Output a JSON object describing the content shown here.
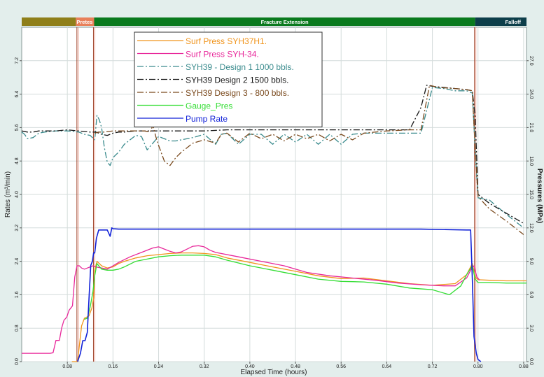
{
  "chart_data": {
    "type": "line",
    "xlabel": "Elapsed Time (hours)",
    "ylabel_left": "Rates (m³/min)",
    "ylabel_right": "Pressures (MPa)",
    "xlim": [
      0.0,
      0.885
    ],
    "ylim_left": [
      0.0,
      8.0
    ],
    "ylim_right": [
      0.0,
      30.0
    ],
    "x_ticks": [
      "0.08",
      "0.16",
      "0.24",
      "0.32",
      "0.40",
      "0.48",
      "0.56",
      "0.64",
      "0.72",
      "0.80",
      "0.88"
    ],
    "x_tick_values": [
      0.08,
      0.16,
      0.24,
      0.32,
      0.4,
      0.48,
      0.56,
      0.64,
      0.72,
      0.8,
      0.88
    ],
    "y_left_ticks": [
      "0.0",
      "0.8",
      "1.6",
      "2.4",
      "3.2",
      "4.0",
      "4.8",
      "5.6",
      "6.4",
      "7.2"
    ],
    "y_left_tick_values": [
      0.0,
      0.8,
      1.6,
      2.4,
      3.2,
      4.0,
      4.8,
      5.6,
      6.4,
      7.2
    ],
    "y_right_ticks": [
      "0.0",
      "3.0",
      "6.0",
      "9.0",
      "12.0",
      "15.0",
      "18.0",
      "21.0",
      "24.0",
      "27.0"
    ],
    "y_right_tick_values": [
      0,
      3,
      6,
      9,
      12,
      15,
      18,
      21,
      24,
      27
    ],
    "grid": true,
    "legend_position": "top-center",
    "stages": [
      {
        "name": "",
        "x0": 0.0,
        "x1": 0.095,
        "color": "#8f7f1a"
      },
      {
        "name": "Pretes",
        "x0": 0.095,
        "x1": 0.127,
        "color": "#e8805a"
      },
      {
        "name": "Fracture Extension",
        "x0": 0.127,
        "x1": 0.795,
        "color": "#0a7a1e"
      },
      {
        "name": "Falloff",
        "x0": 0.795,
        "x1": 0.885,
        "color": "#0d3e4a"
      }
    ],
    "stage_markers": [
      0.098,
      0.127,
      0.795
    ],
    "series": [
      {
        "name": "Surf Press SYH37H1.",
        "color": "#f0941c",
        "axis": "right",
        "dash": "solid",
        "x": [
          0.088,
          0.098,
          0.105,
          0.11,
          0.118,
          0.123,
          0.126,
          0.128,
          0.132,
          0.14,
          0.15,
          0.16,
          0.17,
          0.18,
          0.2,
          0.22,
          0.24,
          0.26,
          0.28,
          0.3,
          0.32,
          0.34,
          0.36,
          0.4,
          0.44,
          0.48,
          0.52,
          0.56,
          0.6,
          0.64,
          0.68,
          0.72,
          0.76,
          0.78,
          0.79,
          0.795,
          0.8,
          0.82,
          0.85,
          0.885
        ],
        "y": [
          0.0,
          0.0,
          3.2,
          3.9,
          4.1,
          4.8,
          5.7,
          8.2,
          9.0,
          8.6,
          8.4,
          8.5,
          8.8,
          9.0,
          9.3,
          9.5,
          9.6,
          9.7,
          9.75,
          9.75,
          9.7,
          9.6,
          9.3,
          8.9,
          8.5,
          8.1,
          7.7,
          7.45,
          7.5,
          7.25,
          7.0,
          6.85,
          7.0,
          7.8,
          8.8,
          7.6,
          7.35,
          7.3,
          7.25,
          7.25
        ]
      },
      {
        "name": "Surf Press SYH-34.",
        "color": "#e8279a",
        "axis": "right",
        "dash": "solid",
        "x": [
          0.0,
          0.05,
          0.055,
          0.06,
          0.066,
          0.07,
          0.074,
          0.079,
          0.083,
          0.089,
          0.093,
          0.097,
          0.101,
          0.105,
          0.11,
          0.115,
          0.12,
          0.125,
          0.13,
          0.14,
          0.15,
          0.16,
          0.17,
          0.19,
          0.21,
          0.23,
          0.24,
          0.25,
          0.26,
          0.27,
          0.28,
          0.29,
          0.3,
          0.31,
          0.32,
          0.33,
          0.34,
          0.38,
          0.42,
          0.46,
          0.5,
          0.54,
          0.58,
          0.62,
          0.66,
          0.7,
          0.74,
          0.76,
          0.78,
          0.788,
          0.793,
          0.798,
          0.803
        ],
        "y": [
          0.75,
          0.75,
          0.8,
          1.9,
          1.9,
          3.0,
          3.7,
          4.0,
          4.6,
          5.0,
          7.6,
          8.6,
          8.6,
          8.4,
          8.3,
          8.4,
          8.5,
          8.6,
          8.5,
          8.4,
          8.3,
          8.6,
          8.9,
          9.4,
          9.8,
          10.2,
          10.3,
          10.1,
          9.9,
          9.75,
          9.85,
          10.1,
          10.35,
          10.4,
          10.3,
          10.0,
          9.8,
          9.4,
          9.0,
          8.6,
          8.0,
          7.7,
          7.5,
          7.3,
          7.05,
          6.9,
          6.8,
          6.8,
          7.5,
          8.3,
          8.6,
          7.6,
          7.3
        ]
      },
      {
        "name": "SYH39 - Design 1 1000 bbls.",
        "color": "#3a8b8d",
        "axis": "right",
        "dash": "dashdot",
        "x": [
          0.0,
          0.005,
          0.01,
          0.02,
          0.03,
          0.04,
          0.06,
          0.08,
          0.1,
          0.11,
          0.12,
          0.128,
          0.132,
          0.136,
          0.14,
          0.145,
          0.15,
          0.155,
          0.16,
          0.166,
          0.17,
          0.18,
          0.2,
          0.21,
          0.22,
          0.24,
          0.26,
          0.27,
          0.28,
          0.3,
          0.32,
          0.34,
          0.35,
          0.36,
          0.38,
          0.4,
          0.42,
          0.44,
          0.46,
          0.48,
          0.5,
          0.52,
          0.54,
          0.56,
          0.58,
          0.6,
          0.64,
          0.67,
          0.7,
          0.72,
          0.74,
          0.76,
          0.78,
          0.79,
          0.795,
          0.8,
          0.82,
          0.85,
          0.88
        ],
        "y": [
          20.6,
          20.4,
          20.0,
          20.1,
          20.5,
          20.6,
          20.7,
          20.7,
          20.6,
          20.4,
          20.3,
          19.9,
          22.1,
          21.7,
          21.0,
          19.2,
          17.9,
          17.6,
          18.3,
          18.6,
          18.8,
          19.5,
          20.3,
          20.2,
          19.0,
          20.2,
          19.8,
          19.8,
          19.9,
          20.1,
          20.4,
          19.5,
          20.4,
          20.5,
          19.5,
          20.4,
          20.4,
          19.5,
          20.4,
          19.7,
          20.4,
          19.5,
          20.4,
          19.5,
          20.4,
          20.5,
          20.5,
          20.5,
          20.5,
          24.6,
          24.5,
          24.3,
          24.3,
          24.1,
          19.0,
          14.7,
          14.5,
          13.2,
          12.0
        ]
      },
      {
        "name": "SYH39 Design 2 1500 bbls.",
        "color": "#181818",
        "axis": "right",
        "dash": "dashdot",
        "x": [
          0.0,
          0.01,
          0.02,
          0.03,
          0.04,
          0.06,
          0.08,
          0.1,
          0.12,
          0.13,
          0.14,
          0.15,
          0.16,
          0.17,
          0.18,
          0.2,
          0.24,
          0.28,
          0.32,
          0.36,
          0.4,
          0.44,
          0.48,
          0.52,
          0.56,
          0.6,
          0.64,
          0.68,
          0.7,
          0.71,
          0.72,
          0.74,
          0.76,
          0.78,
          0.79,
          0.795,
          0.8,
          0.82,
          0.85,
          0.88
        ],
        "y": [
          20.7,
          20.6,
          20.6,
          20.7,
          20.7,
          20.7,
          20.8,
          20.7,
          20.6,
          20.6,
          20.4,
          20.3,
          20.5,
          20.6,
          20.6,
          20.7,
          20.7,
          20.7,
          20.7,
          20.8,
          20.8,
          20.8,
          20.8,
          20.8,
          20.8,
          20.8,
          20.8,
          20.8,
          22.8,
          24.8,
          24.7,
          24.6,
          24.5,
          24.4,
          24.3,
          22.0,
          15.0,
          14.2,
          13.3,
          12.4
        ]
      },
      {
        "name": "SYH39 Design 3 - 800 bbls.",
        "color": "#7a4a1e",
        "axis": "right",
        "dash": "dashdot",
        "x": [
          0.128,
          0.135,
          0.145,
          0.16,
          0.18,
          0.2,
          0.215,
          0.225,
          0.23,
          0.235,
          0.24,
          0.25,
          0.26,
          0.27,
          0.28,
          0.3,
          0.32,
          0.34,
          0.35,
          0.36,
          0.38,
          0.4,
          0.42,
          0.44,
          0.46,
          0.48,
          0.5,
          0.52,
          0.54,
          0.56,
          0.58,
          0.6,
          0.64,
          0.68,
          0.7,
          0.715,
          0.73,
          0.76,
          0.78,
          0.79,
          0.795,
          0.8,
          0.82,
          0.85,
          0.88
        ],
        "y": [
          20.5,
          20.6,
          20.6,
          20.7,
          20.7,
          20.7,
          20.7,
          20.6,
          21.2,
          20.2,
          19.4,
          18.0,
          17.6,
          18.3,
          18.8,
          19.6,
          19.9,
          19.6,
          20.4,
          20.5,
          19.7,
          20.5,
          20.0,
          20.4,
          19.8,
          20.4,
          20.0,
          20.4,
          19.8,
          20.4,
          19.9,
          20.5,
          20.7,
          20.8,
          20.8,
          24.8,
          24.6,
          24.5,
          24.4,
          24.3,
          19.0,
          14.8,
          13.7,
          12.6,
          11.4
        ]
      },
      {
        "name": "Gauge_Pres",
        "color": "#33dd33",
        "axis": "right",
        "dash": "solid",
        "x": [
          0.11,
          0.115,
          0.12,
          0.125,
          0.128,
          0.132,
          0.14,
          0.15,
          0.16,
          0.17,
          0.18,
          0.2,
          0.22,
          0.24,
          0.26,
          0.28,
          0.3,
          0.32,
          0.34,
          0.36,
          0.4,
          0.44,
          0.48,
          0.52,
          0.56,
          0.6,
          0.64,
          0.68,
          0.72,
          0.75,
          0.77,
          0.78,
          0.79,
          0.795,
          0.8,
          0.82,
          0.85,
          0.885
        ],
        "y": [
          3.8,
          3.9,
          4.9,
          6.3,
          7.7,
          8.8,
          8.3,
          8.2,
          8.2,
          8.3,
          8.5,
          9.0,
          9.2,
          9.4,
          9.5,
          9.55,
          9.55,
          9.55,
          9.4,
          9.1,
          8.6,
          8.2,
          7.8,
          7.4,
          7.2,
          7.15,
          6.95,
          6.6,
          6.45,
          6.0,
          6.8,
          7.8,
          8.6,
          7.4,
          7.1,
          7.1,
          7.05,
          7.05
        ]
      },
      {
        "name": "Pump Rate",
        "color": "#1222d8",
        "axis": "left",
        "dash": "solid",
        "x": [
          0.098,
          0.103,
          0.107,
          0.111,
          0.115,
          0.118,
          0.121,
          0.124,
          0.126,
          0.128,
          0.131,
          0.135,
          0.14,
          0.15,
          0.155,
          0.158,
          0.16,
          0.17,
          0.2,
          0.3,
          0.4,
          0.5,
          0.6,
          0.7,
          0.78,
          0.787,
          0.79,
          0.793,
          0.797,
          0.8,
          0.805
        ],
        "y": [
          0.0,
          0.2,
          0.5,
          0.5,
          0.7,
          1.5,
          2.3,
          2.4,
          2.6,
          2.6,
          2.95,
          3.15,
          3.15,
          3.15,
          3.0,
          3.2,
          3.18,
          3.17,
          3.17,
          3.17,
          3.17,
          3.17,
          3.17,
          3.17,
          3.15,
          3.15,
          2.0,
          0.6,
          0.2,
          0.05,
          0.0
        ]
      }
    ]
  }
}
